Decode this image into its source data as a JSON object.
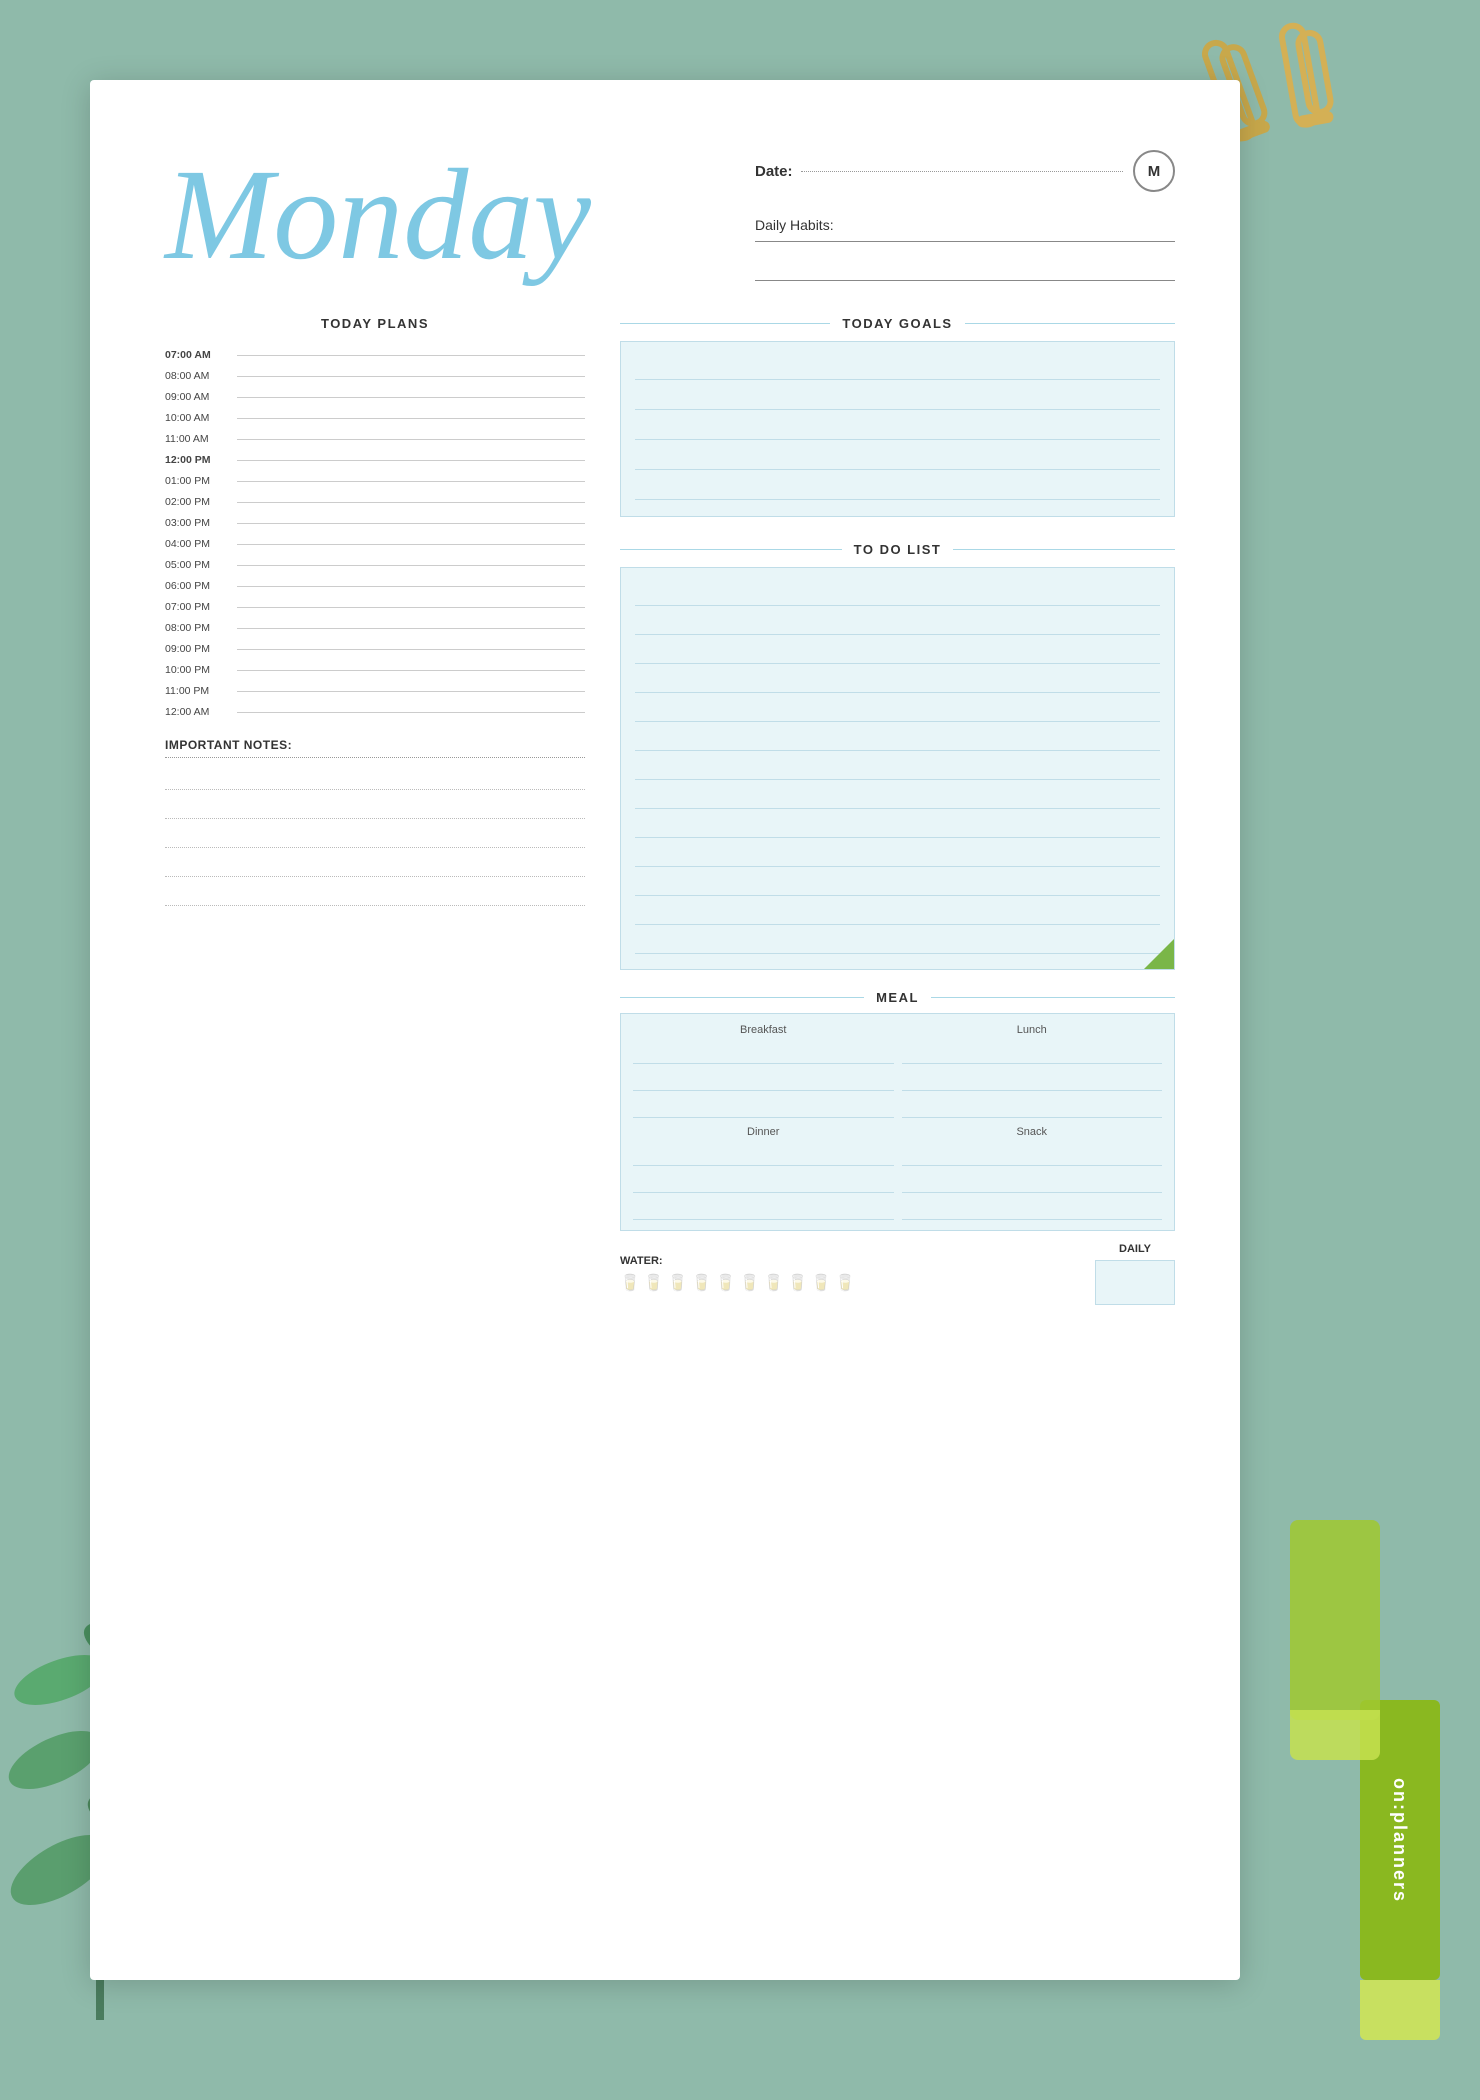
{
  "background": {
    "color": "#8fbaaa"
  },
  "header": {
    "day_title": "Monday",
    "date_label": "Date:",
    "monday_initial": "M",
    "daily_habits_label": "Daily Habits:"
  },
  "today_plans": {
    "section_title": "TODAY PLANS",
    "time_slots": [
      {
        "time": "07:00 AM",
        "bold": true
      },
      {
        "time": "08:00 AM",
        "bold": false
      },
      {
        "time": "09:00 AM",
        "bold": false
      },
      {
        "time": "10:00 AM",
        "bold": false
      },
      {
        "time": "11:00 AM",
        "bold": false
      },
      {
        "time": "12:00 PM",
        "bold": true
      },
      {
        "time": "01:00 PM",
        "bold": false
      },
      {
        "time": "02:00 PM",
        "bold": false
      },
      {
        "time": "03:00 PM",
        "bold": false
      },
      {
        "time": "04:00 PM",
        "bold": false
      },
      {
        "time": "05:00 PM",
        "bold": false
      },
      {
        "time": "06:00 PM",
        "bold": false
      },
      {
        "time": "07:00 PM",
        "bold": false
      },
      {
        "time": "08:00 PM",
        "bold": false
      },
      {
        "time": "09:00 PM",
        "bold": false
      },
      {
        "time": "10:00 PM",
        "bold": false
      },
      {
        "time": "11:00 PM",
        "bold": false
      },
      {
        "time": "12:00 AM",
        "bold": false
      }
    ]
  },
  "today_goals": {
    "section_title": "TODAY GOALS",
    "lines_count": 5
  },
  "todo_list": {
    "section_title": "TO DO LIST",
    "lines_count": 13
  },
  "meal": {
    "section_title": "MEAL",
    "breakfast_label": "Breakfast",
    "lunch_label": "Lunch",
    "dinner_label": "Dinner",
    "snack_label": "Snack"
  },
  "important_notes": {
    "label": "IMPORTANT NOTES:",
    "lines_count": 5
  },
  "water": {
    "label": "WATER:",
    "glasses_count": 10,
    "daily_label": "DAILY"
  }
}
